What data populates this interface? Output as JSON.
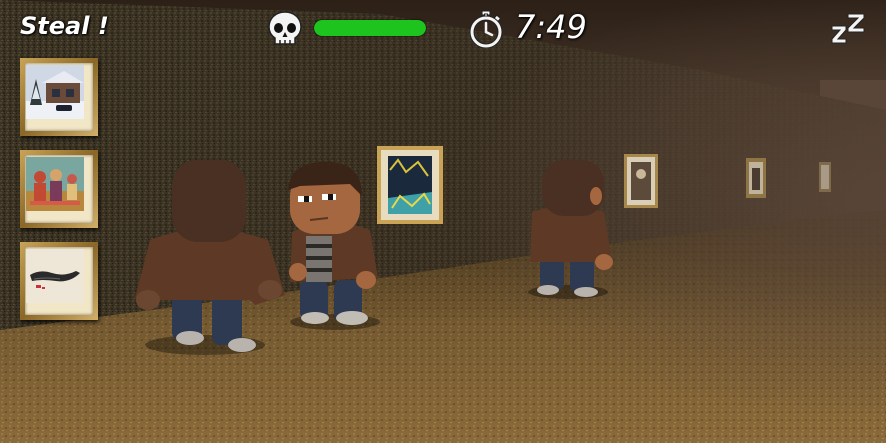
{
  "hud": {
    "steal_label": "Steal !",
    "timer": "7:49",
    "health_level": 1.0,
    "icons": {
      "health": "skull-icon",
      "timer": "stopwatch-icon",
      "sleep": "sleep-zz-icon"
    },
    "colors": {
      "health_fill": "#1ec41e",
      "health_track": "#0d3a0d",
      "text": "#ffffff"
    }
  },
  "inventory": {
    "slots": [
      {
        "icon": "snowy-house-painting-icon"
      },
      {
        "icon": "figures-painting-icon"
      },
      {
        "icon": "sketch-painting-icon"
      }
    ]
  }
}
